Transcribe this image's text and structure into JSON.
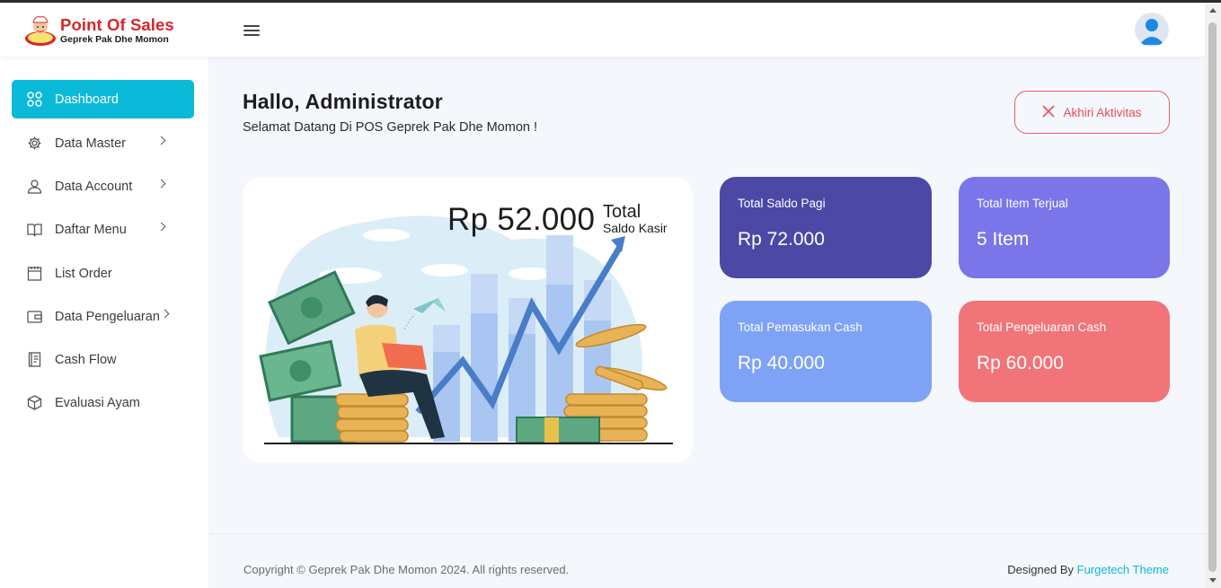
{
  "app": {
    "logo_title": "Point Of Sales",
    "logo_subtitle": "Geprek Pak Dhe Momon",
    "brand_color": "#d7262a",
    "accent_color": "#0bbad8"
  },
  "header": {
    "menu_icon": "hamburger-icon",
    "avatar_icon": "user-avatar-icon"
  },
  "sidebar": {
    "items": [
      {
        "label": "Dashboard",
        "icon": "grid-icon",
        "active": true
      },
      {
        "label": "Data Master",
        "icon": "gear-icon",
        "chevron": true
      },
      {
        "label": "Data Account",
        "icon": "user-icon",
        "chevron": true
      },
      {
        "label": "Daftar Menu",
        "icon": "book-icon",
        "chevron": true
      },
      {
        "label": "List Order",
        "icon": "calendar-icon"
      },
      {
        "label": "Data Pengeluaran",
        "icon": "wallet-icon",
        "chevron": true
      },
      {
        "label": "Cash Flow",
        "icon": "ledger-icon"
      },
      {
        "label": "Evaluasi Ayam",
        "icon": "box-icon"
      }
    ]
  },
  "main": {
    "greeting_title": "Hallo, Administrator",
    "greeting_subtitle": "Selamat Datang Di POS Geprek Pak Dhe Momon !",
    "end_button_label": "Akhiri Aktivitas",
    "hero": {
      "amount": "Rp 52.000",
      "label_line1": "Total",
      "label_line2": "Saldo Kasir"
    },
    "cards": [
      {
        "label": "Total Saldo Pagi",
        "value": "Rp 72.000",
        "color": "#4b48a6"
      },
      {
        "label": "Total Item Terjual",
        "value": "5 Item",
        "color": "#7a75e8"
      },
      {
        "label": "Total Pemasukan Cash",
        "value": "Rp 40.000",
        "color": "#7ea2f5"
      },
      {
        "label": "Total Pengeluaran Cash",
        "value": "Rp 60.000",
        "color": "#f17479"
      }
    ]
  },
  "footer": {
    "copyright": "Copyright © Geprek Pak Dhe Momon 2024. All rights reserved.",
    "designed_prefix": "Designed By",
    "designed_link": "Furgetech Theme"
  }
}
